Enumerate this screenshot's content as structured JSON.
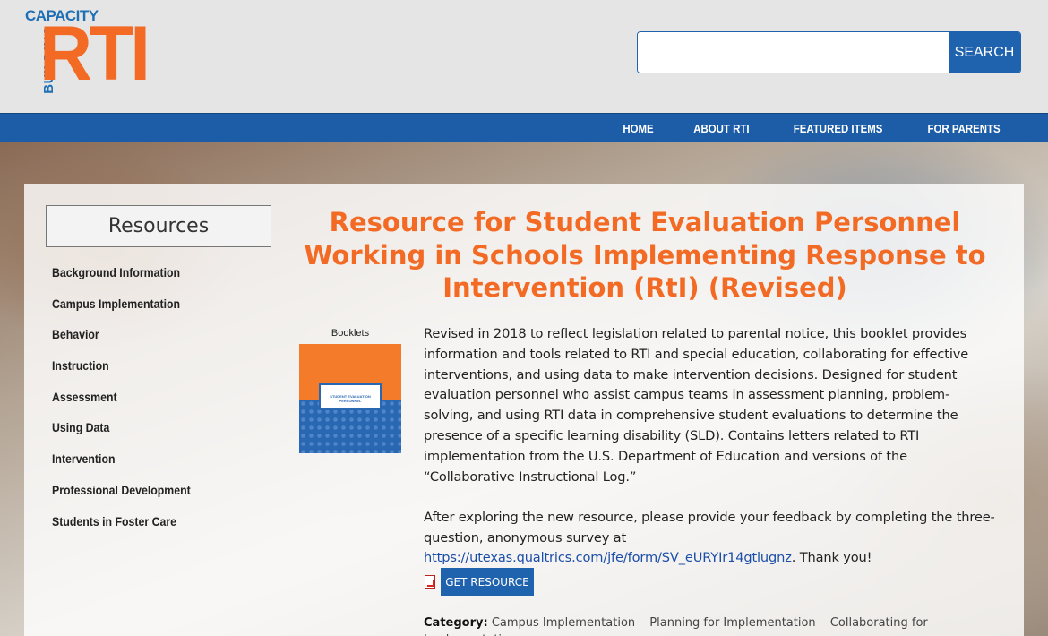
{
  "header": {
    "logo": {
      "top_text": "CAPACITY",
      "side_text": "BUILDING",
      "main_text": "RTI"
    },
    "search": {
      "placeholder": "",
      "value": "",
      "button_label": "SEARCH"
    }
  },
  "nav": {
    "items": [
      "HOME",
      "ABOUT RTI",
      "FEATURED ITEMS",
      "FOR PARENTS"
    ]
  },
  "sidebar": {
    "title": "Resources",
    "items": [
      "Background Information",
      "Campus Implementation",
      "Behavior",
      "Instruction",
      "Assessment",
      "Using Data",
      "Intervention",
      "Professional Development",
      "Students in Foster Care"
    ]
  },
  "main": {
    "title": "Resource for Student Evaluation Personnel Working in Schools Implementing Response to Intervention (RtI) (Revised)",
    "thumbnail_label": "Booklets",
    "booklet_cover_text": "STUDENT EVALUATION PERSONNEL",
    "description": "Revised in 2018 to reflect legislation related to parental notice, this booklet provides information and tools related to RTI and special education, collaborating for effective interventions, and using data to make intervention decisions. Designed for student evaluation personnel who assist campus teams in assessment planning, problem-solving, and using RTI data in comprehensive student evaluations to determine the presence of a specific learning disability (SLD). Contains letters related to RTI implementation from the U.S. Department of Education and versions of the “Collaborative Instructional Log.”",
    "feedback_text": "After exploring the new resource, please provide your feedback by completing the three-question, anonymous survey at",
    "survey_link": "https://utexas.qualtrics.com/jfe/form/SV_eURYIr14gtlugnz",
    "thanks": ". Thank you!",
    "get_button": "GET RESOURCE",
    "category_label": "Category:",
    "categories": [
      "Campus Implementation",
      "Planning for Implementation",
      "Collaborating for Implementation"
    ]
  },
  "colors": {
    "accent_orange": "#f26a24",
    "brand_blue": "#1f62ad",
    "nav_blue": "#1d5ca7"
  }
}
